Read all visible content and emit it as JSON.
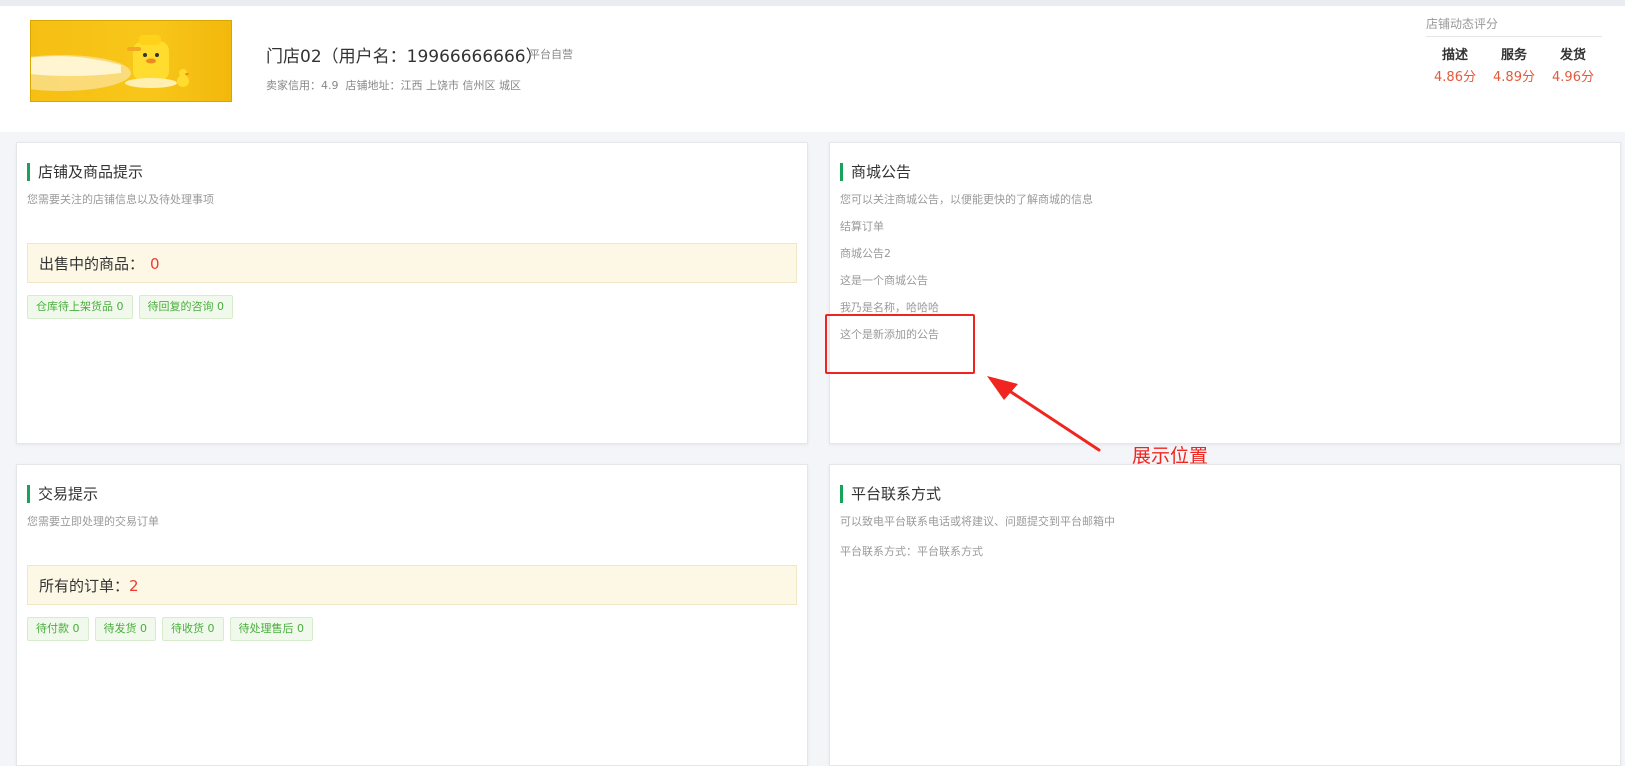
{
  "header": {
    "store_name": "门店02（用户名：19966666666）",
    "store_tag": "平台自营",
    "seller_credit_label": "卖家信用：",
    "seller_credit_value": "4.9",
    "address_label": "店铺地址：",
    "address_value": "江西 上饶市 信州区 城区"
  },
  "rating": {
    "title": "店铺动态评分",
    "items": [
      {
        "label": "描述",
        "value": "4.86分"
      },
      {
        "label": "服务",
        "value": "4.89分"
      },
      {
        "label": "发货",
        "value": "4.96分"
      }
    ]
  },
  "store_goods": {
    "title": "店铺及商品提示",
    "subtitle": "您需要关注的店铺信息以及待处理事项",
    "highlight_label": "出售中的商品：",
    "highlight_value": "0",
    "tags": [
      "仓库待上架货品 0",
      "待回复的咨询 0"
    ]
  },
  "mall_notice": {
    "title": "商城公告",
    "subtitle": "您可以关注商城公告，以便能更快的了解商城的信息",
    "items": [
      "结算订单",
      "商城公告2",
      "这是一个商城公告",
      "我乃是名称，哈哈哈",
      "这个是新添加的公告"
    ]
  },
  "trade": {
    "title": "交易提示",
    "subtitle": "您需要立即处理的交易订单",
    "highlight_label": "所有的订单：",
    "highlight_value": "2",
    "tags": [
      "待付款 0",
      "待发货 0",
      "待收货 0",
      "待处理售后 0"
    ]
  },
  "contact": {
    "title": "平台联系方式",
    "subtitle": "可以致电平台联系电话或将建议、问题提交到平台邮箱中",
    "line": "平台联系方式：平台联系方式"
  },
  "annotation": {
    "text": "展示位置",
    "color": "#f0251f"
  },
  "colors": {
    "accent_green": "#19a35a",
    "rating_red": "#e4593b",
    "highlight_bg": "#fdf8e6",
    "tag_green": "#4aae3d"
  }
}
